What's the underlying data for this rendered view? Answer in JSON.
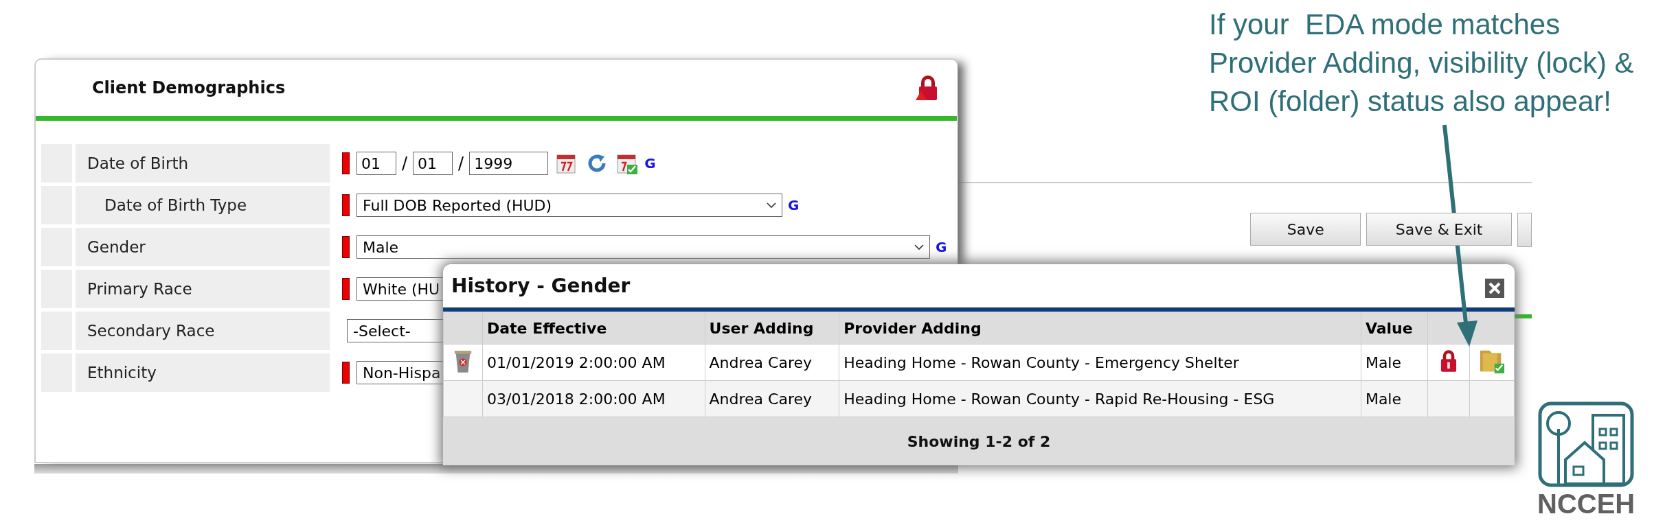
{
  "annotation": "If your  EDA mode matches Provider Adding, visibility (lock) & ROI (folder) status also appear!",
  "panel": {
    "title": "Client Demographics",
    "fields": [
      {
        "label": "Date of Birth",
        "kind": "date",
        "sub": false,
        "required": true,
        "parts": [
          "01",
          "01",
          "1999"
        ],
        "separators": [
          "/",
          "/"
        ],
        "link": "G"
      },
      {
        "label": "Date of Birth Type",
        "kind": "select",
        "sub": true,
        "required": true,
        "value": "Full DOB Reported (HUD)",
        "link": "G"
      },
      {
        "label": "Gender",
        "kind": "select",
        "sub": false,
        "required": true,
        "value": "Male",
        "link": "G"
      },
      {
        "label": "Primary Race",
        "kind": "select",
        "sub": false,
        "required": true,
        "value": "White (HU"
      },
      {
        "label": "Secondary Race",
        "kind": "select",
        "sub": false,
        "required": false,
        "value": "-Select-"
      },
      {
        "label": "Ethnicity",
        "kind": "select",
        "sub": false,
        "required": true,
        "value": "Non-Hispa"
      }
    ]
  },
  "buttons": [
    "Save",
    "Save & Exit"
  ],
  "history": {
    "title": "History - Gender",
    "columns": [
      "Date Effective",
      "User Adding",
      "Provider Adding",
      "Value"
    ],
    "rows": [
      {
        "deletable": true,
        "date": "01/01/2019 2:00:00 AM",
        "user": "Andrea Carey",
        "provider": "Heading Home - Rowan County - Emergency Shelter",
        "value": "Male",
        "locked": true,
        "roi": true
      },
      {
        "deletable": false,
        "date": "03/01/2018 2:00:00 AM",
        "user": "Andrea Carey",
        "provider": "Heading Home - Rowan County - Rapid Re-Housing - ESG",
        "value": "Male",
        "locked": false,
        "roi": false
      }
    ],
    "footer": "Showing 1-2 of 2"
  },
  "logo": "NCCEH"
}
